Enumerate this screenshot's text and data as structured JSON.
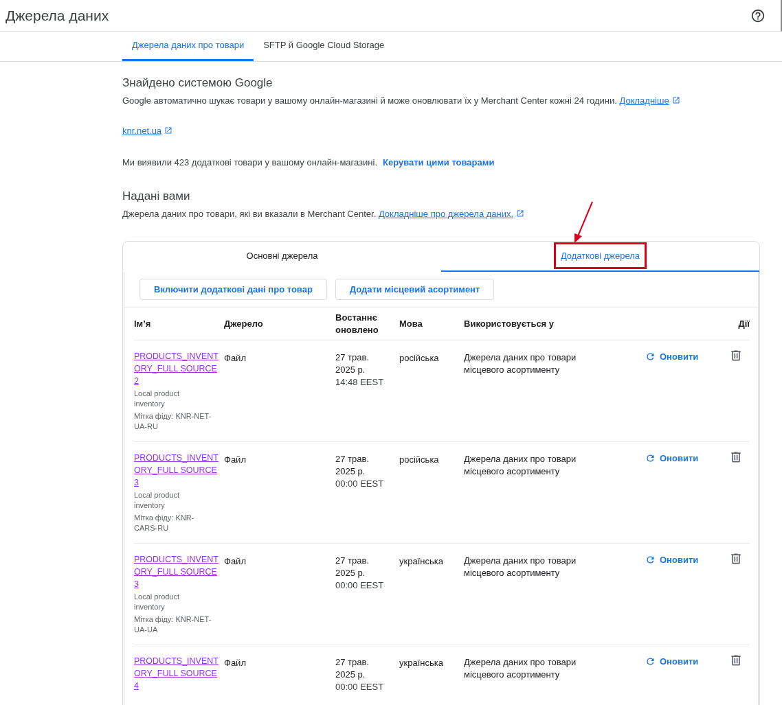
{
  "header": {
    "title": "Джерела даних"
  },
  "tabs": [
    {
      "label": "Джерела даних про товари",
      "selected": true
    },
    {
      "label": "SFTP й Google Cloud Storage",
      "selected": false
    }
  ],
  "found": {
    "heading": "Знайдено системою Google",
    "text": "Google автоматично шукає товари у вашому онлайн-магазині й може оновлювати їх у Merchant Center кожні 24 години.",
    "link": "Докладніше",
    "site": "knr.net.ua",
    "extra_text": "Ми виявили 423 додаткові товари у вашому онлайн-магазині.",
    "extra_link": "Керувати цими товарами"
  },
  "provided": {
    "heading": "Надані вами",
    "text": "Джерела даних про товари, які ви вказали в Merchant Center.",
    "link": "Докладніше про джерела даних."
  },
  "source_tabs": [
    {
      "label": "Основні джерела",
      "selected": false,
      "highlighted": false
    },
    {
      "label": "Додаткові джерела",
      "selected": true,
      "highlighted": true
    }
  ],
  "buttons": [
    "Включити додаткові дані про товар",
    "Додати місцевий асортимент"
  ],
  "table": {
    "columns": [
      "Ім’я",
      "Джерело",
      "Востаннє оновлено",
      "Мова",
      "Використовується у",
      "Дії"
    ],
    "rows": [
      {
        "name": "PRODUCTS_INVENTORY_FULL SOURCE 2",
        "type": "Local product inventory",
        "feed": "Мітка фіду: KNR-NET-UA-RU",
        "source": "Файл",
        "date": "27 трав. 2025 р.",
        "time": "14:48 EEST",
        "language": "російська",
        "used_in": "Джерела даних про товари місцевого асортименту",
        "action": "Оновити"
      },
      {
        "name": "PRODUCTS_INVENTORY_FULL SOURCE 3",
        "type": "Local product inventory",
        "feed": "Мітка фіду: KNR-CARS-RU",
        "source": "Файл",
        "date": "27 трав. 2025 р.",
        "time": "00:00 EEST",
        "language": "російська",
        "used_in": "Джерела даних про товари місцевого асортименту",
        "action": "Оновити"
      },
      {
        "name": "PRODUCTS_INVENTORY_FULL SOURCE 3",
        "type": "Local product inventory",
        "feed": "Мітка фіду: KNR-NET-UA-UA",
        "source": "Файл",
        "date": "27 трав. 2025 р.",
        "time": "00:00 EEST",
        "language": "українська",
        "used_in": "Джерела даних про товари місцевого асортименту",
        "action": "Оновити"
      },
      {
        "name": "PRODUCTS_INVENTORY_FULL SOURCE 4",
        "source": "Файл",
        "date": "27 трав. 2025 р.",
        "time": "00:00 EEST",
        "language": "українська",
        "used_in": "Джерела даних про товари місцевого асортименту",
        "action": "Оновити"
      }
    ]
  }
}
